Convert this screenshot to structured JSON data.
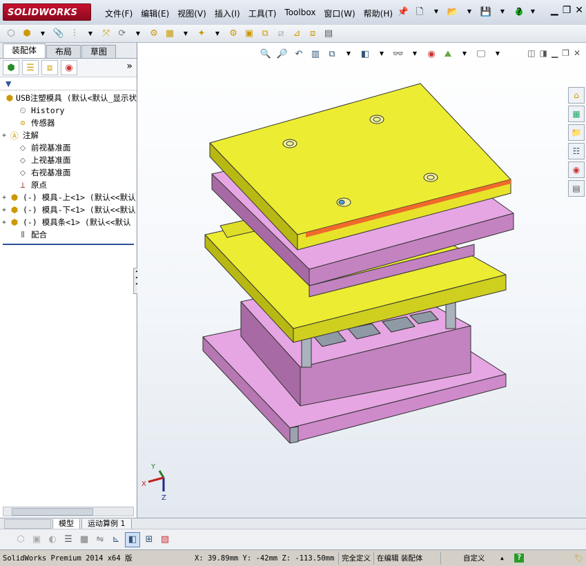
{
  "app": {
    "logo_text": "SOLIDWORKS",
    "menu": [
      "文件(F)",
      "编辑(E)",
      "视图(V)",
      "插入(I)",
      "工具(T)",
      "Toolbox",
      "窗口(W)",
      "帮助(H)"
    ],
    "help_label": "?"
  },
  "sidebar": {
    "tabs": [
      "装配体",
      "布局",
      "草图"
    ],
    "expand_glyph": "»",
    "filter_glyph": "▼",
    "tree": [
      {
        "label": "USB注塑模具  (默认<默认_显示状",
        "icon": "assembly-icon",
        "expand": ""
      },
      {
        "label": "History",
        "icon": "history-icon",
        "expand": ""
      },
      {
        "label": "传感器",
        "icon": "sensor-icon",
        "expand": ""
      },
      {
        "label": "注解",
        "icon": "annotation-icon",
        "expand": "+"
      },
      {
        "label": "前视基准面",
        "icon": "plane-icon",
        "expand": ""
      },
      {
        "label": "上视基准面",
        "icon": "plane-icon",
        "expand": ""
      },
      {
        "label": "右视基准面",
        "icon": "plane-icon",
        "expand": ""
      },
      {
        "label": "原点",
        "icon": "origin-icon",
        "expand": ""
      },
      {
        "label": "(-) 模具-上<1> (默认<<默认",
        "icon": "part-icon",
        "expand": "+"
      },
      {
        "label": "(-) 模具-下<1> (默认<<默认",
        "icon": "part-icon",
        "expand": "+"
      },
      {
        "label": "(-) 模具条<1> (默认<<默认",
        "icon": "part-icon",
        "expand": "+"
      },
      {
        "label": "配合",
        "icon": "mates-icon",
        "expand": ""
      }
    ]
  },
  "bottom_tabs": [
    "模型",
    "运动算例 1"
  ],
  "triad": {
    "x": "X",
    "y": "Y",
    "z": "Z"
  },
  "status": {
    "version": "SolidWorks Premium 2014 x64 版",
    "coords": "X: 39.89mm Y: -42mm Z: -113.50mm",
    "definition": "完全定义",
    "editing": "在编辑 装配体",
    "custom": "自定义",
    "custom_arrow": "▲",
    "help_icon": "?"
  },
  "colors": {
    "plate_yellow": "#ecec33",
    "plate_pink": "#e6a6e3",
    "brand_red": "#c8102e"
  }
}
